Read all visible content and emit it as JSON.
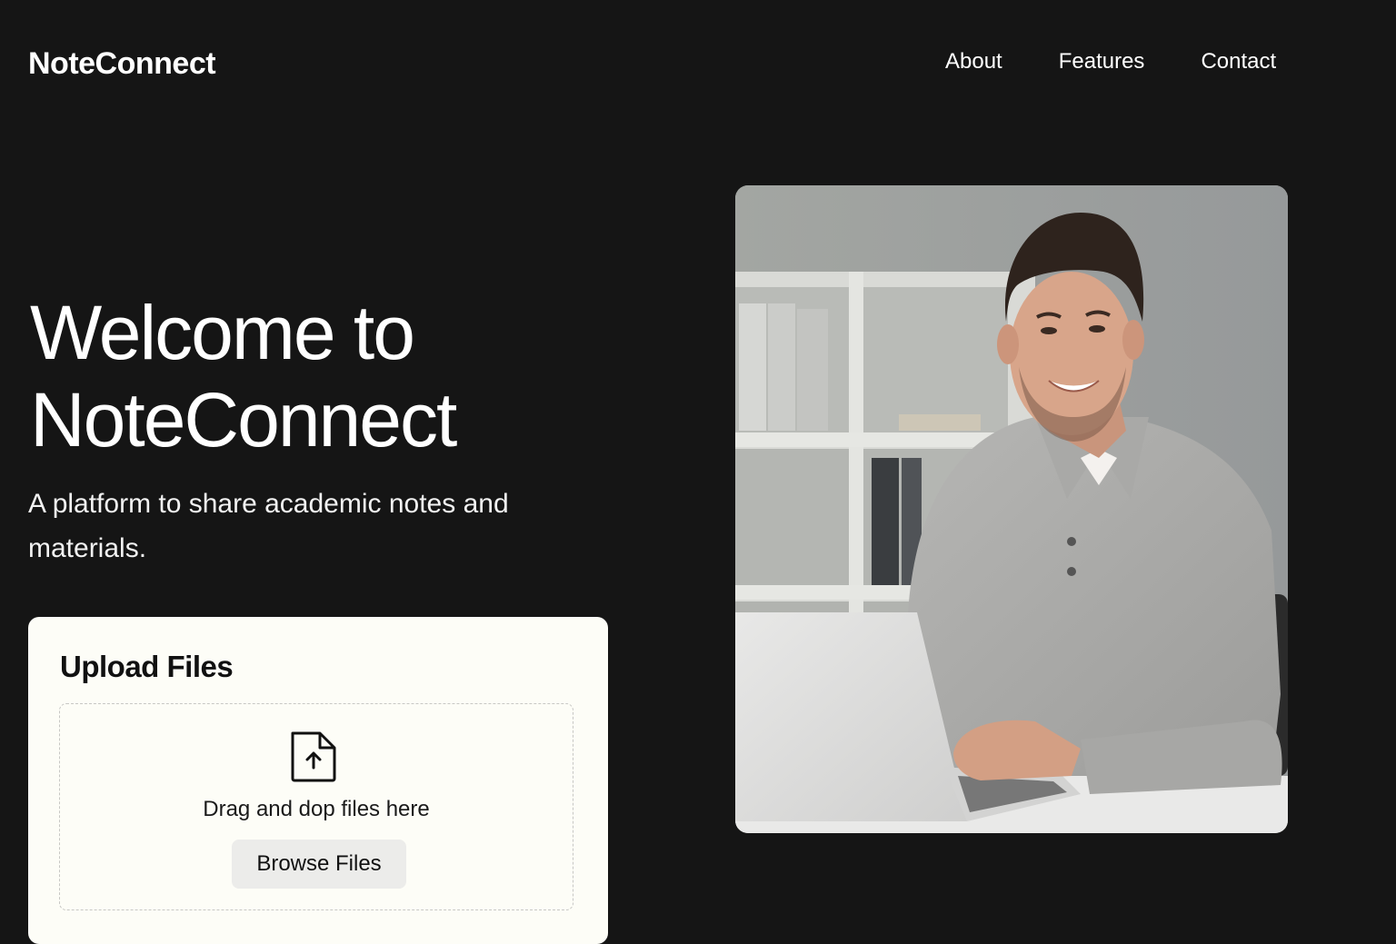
{
  "header": {
    "logo": "NoteConnect",
    "nav": [
      {
        "label": "About"
      },
      {
        "label": "Features"
      },
      {
        "label": "Contact"
      }
    ]
  },
  "hero": {
    "title_line1": "Welcome to",
    "title_line2": "NoteConnect",
    "subtitle": "A platform to share academic notes and materials.",
    "image_alt": "Smiling man in a gray polo shirt typing on a laptop at a desk in an office"
  },
  "upload": {
    "title": "Upload Files",
    "drop_text": "Drag and dop files here",
    "browse_label": "Browse Files",
    "icon": "file-upload-icon"
  },
  "colors": {
    "background": "#151515",
    "text": "#ffffff",
    "card": "#fdfdf7",
    "button": "#ececea"
  }
}
